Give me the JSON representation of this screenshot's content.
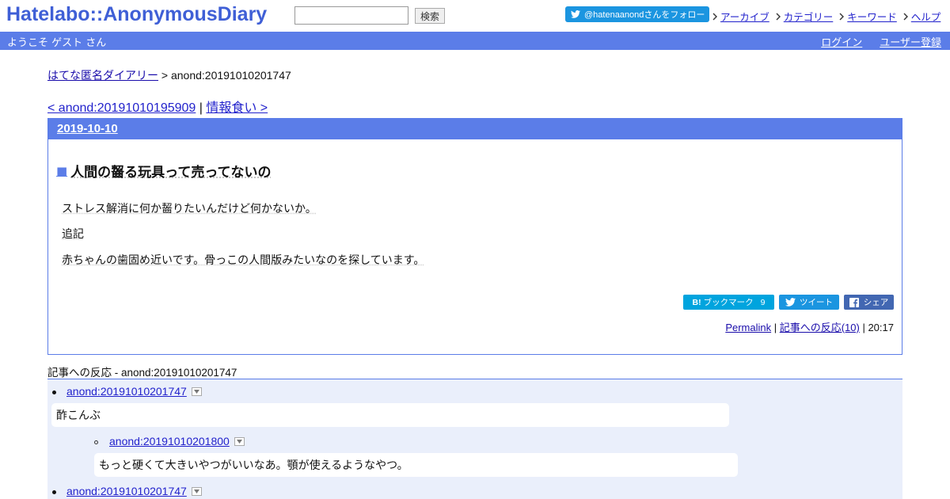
{
  "header": {
    "logo": "Hatelabo::AnonymousDiary",
    "search_value": "",
    "search_button": "検索",
    "follow_button": "@hatenaanondさんをフォロー",
    "links": [
      "アーカイブ",
      "カテゴリー",
      "キーワード",
      "ヘルプ"
    ]
  },
  "userbar": {
    "welcome": "ようこそ ゲスト さん",
    "login": "ログイン",
    "register": "ユーザー登録"
  },
  "breadcrumb": {
    "home": "はてな匿名ダイアリー",
    "sep": " > ",
    "current": "anond:20191010201747"
  },
  "pager": {
    "prev": "< anond:20191010195909",
    "sep": " | ",
    "next": "情報食い >"
  },
  "entry": {
    "date": "2019-10-10",
    "mark": "■",
    "title": "人間の齧る玩具って売ってないの",
    "paragraphs": [
      "ストレス解消に何か齧りたいんだけど何かないか。",
      "追記",
      "赤ちゃんの歯固め近いです。骨っこの人間版みたいなのを探しています。"
    ],
    "hatena_bookmark_label": "ブックマーク",
    "hatena_bookmark_count": "9",
    "tweet_label": "ツイート",
    "share_label": "シェア",
    "permalink": "Permalink",
    "meta_sep1": " | ",
    "reactions_link": "記事への反応(10)",
    "meta_sep2": " | ",
    "time": "20:17"
  },
  "reactions": {
    "title": "記事への反応 - anond:20191010201747",
    "items": [
      {
        "id": "anond:20191010201747",
        "text": "酢こんぶ"
      },
      {
        "id": "anond:20191010201800",
        "text": "もっと硬くて大きいやつがいいなあ。顎が使えるようなやつ。"
      },
      {
        "id": "anond:20191010201747",
        "text": ""
      }
    ]
  },
  "colors": {
    "accent": "#5b7de8",
    "reaction_bg": "#eaeffb",
    "hatena_blue": "#00a4de",
    "twitter_blue": "#1b95e0",
    "facebook_blue": "#4267b2"
  }
}
